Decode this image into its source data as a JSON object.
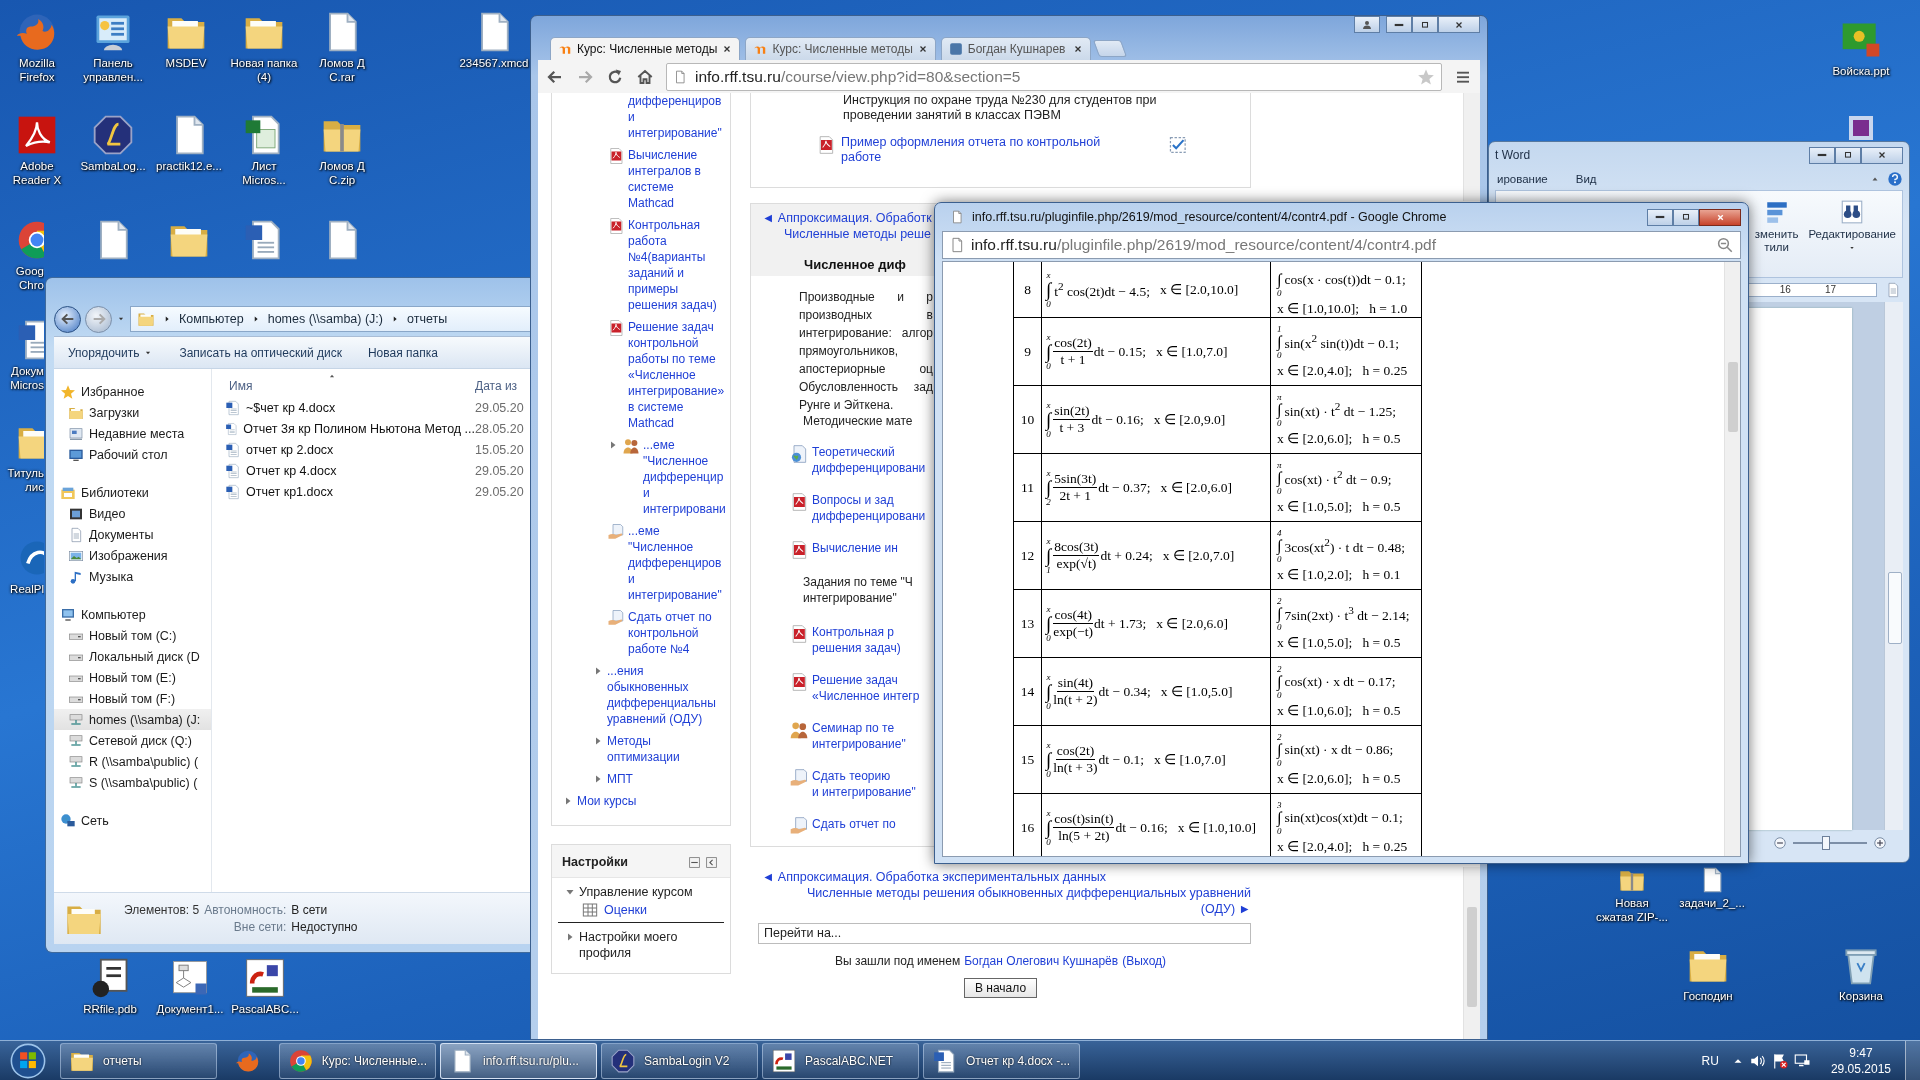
{
  "desktop_icons": [
    {
      "label": "Mozilla\nFirefox",
      "kind": "firefox"
    },
    {
      "label": "Панель\nуправлен...",
      "kind": "control-panel"
    },
    {
      "label": "MSDEV",
      "kind": "folder"
    },
    {
      "label": "Новая папка\n(4)",
      "kind": "folder"
    },
    {
      "label": "Ломов Д\nC.rar",
      "kind": "file"
    },
    {
      "label": "234567.xmcd",
      "kind": "file"
    },
    {
      "label": "Adobe\nReader X",
      "kind": "acrobat"
    },
    {
      "label": "SambaLog...",
      "kind": "samba"
    },
    {
      "label": "practik12.e...",
      "kind": "file"
    },
    {
      "label": "Лист\nMicros...",
      "kind": "excel"
    },
    {
      "label": "Ломов Д\nC.zip",
      "kind": "zip"
    },
    {
      "label": "Goog\nChro",
      "kind": "chrome"
    },
    {
      "kind": "file"
    },
    {
      "kind": "folder"
    },
    {
      "kind": "word"
    },
    {
      "kind": "file"
    },
    {
      "label": "Докум\nMicros",
      "kind": "word"
    },
    {
      "label": "Титуль\nлис",
      "kind": "folder"
    },
    {
      "label": "RealPl",
      "kind": "realplayer"
    },
    {
      "label": "RRfile.pdb",
      "kind": "pdb"
    },
    {
      "label": "Документ1...",
      "kind": "visio"
    },
    {
      "label": "PascalABC...",
      "kind": "pascal"
    },
    {
      "label": "Войска.ppt",
      "kind": "ppt"
    },
    {
      "kind": "media"
    },
    {
      "label": "Новая\nсжатая ZIP-...",
      "kind": "zip"
    },
    {
      "label": "задачи_2_...",
      "kind": "file"
    },
    {
      "label": "Господин",
      "kind": "folder"
    },
    {
      "label": "Корзина",
      "kind": "bin"
    }
  ],
  "explorer": {
    "breadcrumbs": [
      "Компьютер",
      "homes (\\\\samba) (J:)",
      "отчеты"
    ],
    "toolbar": [
      {
        "label": "Упорядочить",
        "menu": true
      },
      {
        "label": "Записать на оптический диск",
        "menu": false
      },
      {
        "label": "Новая папка",
        "menu": false
      }
    ],
    "nav": [
      {
        "label": "Избранное",
        "selected": false,
        "children": [
          {
            "label": "Загрузки",
            "selected": false
          },
          {
            "label": "Недавние места",
            "selected": false
          },
          {
            "label": "Рабочий стол",
            "selected": false
          }
        ]
      },
      {
        "label": "Библиотеки",
        "selected": false,
        "children": [
          {
            "label": "Видео",
            "selected": false
          },
          {
            "label": "Документы",
            "selected": false
          },
          {
            "label": "Изображения",
            "selected": false
          },
          {
            "label": "Музыка",
            "selected": false
          }
        ]
      },
      {
        "label": "Компьютер",
        "selected": false,
        "children": [
          {
            "label": "Новый том (C:)",
            "selected": false
          },
          {
            "label": "Локальный диск (D",
            "selected": false
          },
          {
            "label": "Новый том (E:)",
            "selected": false
          },
          {
            "label": "Новый том (F:)",
            "selected": false
          },
          {
            "label": "homes (\\\\samba) (J:",
            "selected": true
          },
          {
            "label": "Сетевой диск (Q:)",
            "selected": false
          },
          {
            "label": "R (\\\\samba\\public) (",
            "selected": false
          },
          {
            "label": "S (\\\\samba\\public) (",
            "selected": false
          }
        ]
      },
      {
        "label": "Сеть",
        "selected": false
      }
    ],
    "columns": [
      "Имя",
      "Дата из"
    ],
    "files": [
      {
        "name": "~$чет кр 4.docx",
        "date": "29.05.20"
      },
      {
        "name": "Отчет 3я кр Полином Ньютона Метод ...",
        "date": "28.05.20"
      },
      {
        "name": "отчет кр 2.docx",
        "date": "15.05.20"
      },
      {
        "name": "Отчет кр 4.docx",
        "date": "29.05.20"
      },
      {
        "name": "Отчет кр1.docx",
        "date": "29.05.20"
      }
    ],
    "status": {
      "count": "Элементов: 5",
      "offline_label": "Автономность:",
      "offline_value": "В сети",
      "outside_label": "Вне сети:",
      "outside_value": "Недоступно"
    }
  },
  "browser": {
    "tabs": [
      {
        "label": "Курс: Численные методы",
        "selected": true
      },
      {
        "label": "Курс: Численные методы",
        "selected": false
      },
      {
        "label": "Богдан Кушнарев",
        "selected": false
      }
    ],
    "url_host": "info.rff.tsu.ru",
    "url_path": "/course/view.php?id=80&section=5",
    "nav_tree": [
      {
        "children": [
          {
            "children": [
              {
                "kind": "link",
                "text": "дифференциров\nи\nинтегрирование\""
              },
              {
                "kind": "pdf",
                "text": "Вычисление\nинтегралов в\nсистеме\nMathcad"
              },
              {
                "kind": "pdf",
                "text": "Контрольная\nработа\n№4(варианты\nзаданий и\nпримеры\nрешения задач)"
              },
              {
                "kind": "pdf",
                "text": "Решение задач\nконтрольной\nработы по теме\n«Численное\nинтегрирование»\nв системе\nMathcad"
              },
              {
                "kind": "forum",
                "expanded": false,
                "text": "...еме\n\"Численное\nдифференцир\nи\nинтегрировани"
              },
              {
                "kind": "assign",
                "text": "...еме\n\"Численное\nдифференциров\nи\nинтегрирование\""
              },
              {
                "kind": "assign",
                "text": "Сдать отчет по\nконтрольной\nработе №4"
              }
            ]
          },
          {
            "text": "...ения\nобыкновенных\nдифференциальны\nуравнений (ОДУ)",
            "expanded": false
          },
          {
            "text": "Методы\nоптимизации",
            "expanded": false
          },
          {
            "text": "МПТ",
            "expanded": false
          }
        ]
      },
      {
        "text": "Мои курсы",
        "expanded": false
      }
    ],
    "settings": {
      "title": "Настройки",
      "items": [
        {
          "label": "Управление курсом",
          "expanded": true,
          "children": [
            {
              "label": "Оценки"
            }
          ]
        },
        {
          "label": "Настройки моего\nпрофиля",
          "expanded": false
        }
      ]
    },
    "top_box": {
      "lines": [
        "Инструкция по охране труда №230 для студентов при",
        "проведении занятий в классах ПЭВМ"
      ],
      "link": "Пример оформления отчета по контрольной\nработе",
      "done": true
    },
    "section": {
      "prev": "◄ Аппроксимация. Обработк",
      "next": "Численные методы реше",
      "title": "Численное диф",
      "summary": [
        "Производные и р",
        "производных в",
        "интегрирование: алгор",
        "прямоугольников,",
        "апостериорные оц",
        "Обусловленность зад",
        "Рунге и Эйткена."
      ],
      "materials": "Методические мате",
      "activities": [
        {
          "kind": "globe",
          "text": "Теоретический\nдифференцировани"
        },
        {
          "kind": "pdf",
          "text": "Вопросы и зад\nдифференцировани"
        },
        {
          "kind": "pdf",
          "text": "Вычисление ин"
        },
        {
          "kind": "label",
          "text": "Задания по теме \"Ч\nинтегрирование\""
        },
        {
          "kind": "pdf",
          "text": "Контрольная р\nрешения задач)"
        },
        {
          "kind": "pdf",
          "text": "Решение задач\n«Численное интегр"
        },
        {
          "kind": "forum",
          "text": "Семинар по те\nинтегрирование\""
        },
        {
          "kind": "assign",
          "text": "Сдать теорию\nи интегрирование\""
        },
        {
          "kind": "assign",
          "text": "Сдать отчет по"
        }
      ]
    },
    "bottom_nav": {
      "prev": "◄ Аппроксимация. Обработка экспериментальных данных",
      "next": "Численные методы решения обыкновенных дифференциальных уравнений\n(ОДУ) ►"
    },
    "jump": {
      "value": "Перейти на..."
    },
    "login": {
      "prefix": "Вы зашли под именем",
      "user": "Богдан Олегович Кушнарёв",
      "logout": "(Выход)"
    },
    "home_button": "В начало"
  },
  "pdf_viewer": {
    "title": "info.rff.tsu.ru/pluginfile.php/2619/mod_resource/content/4/contr4.pdf - Google Chrome",
    "url_host": "info.rff.tsu.ru",
    "url_path": "/pluginfile.php/2619/mod_resource/content/4/contr4.pdf",
    "rows": [
      {
        "n": "8",
        "a": {
          "kind": "plain",
          "sign": "∫",
          "upper": "x",
          "lower": "0",
          "body": "t$^{2}$ cos(2t)dt − 4.5;",
          "range": "x ∈ [2.0,10.0]"
        },
        "b": {
          "sign": "∫",
          "lower": "0",
          "body": "cos(x · cos(t))dt − 0.1;",
          "cond": "x ∈ [1.0,10.0];   h = 1.0"
        }
      },
      {
        "n": "9",
        "a": {
          "kind": "fraction",
          "sign": "∫",
          "upper": "x",
          "lower": "0",
          "num": "cos(2t)",
          "den": "t + 1",
          "tail": "dt − 0.15;",
          "range": "x ∈ [1.0,7.0]"
        },
        "b": {
          "sign": "∫",
          "upper": "1",
          "lower": "0",
          "body": "sin(x$^{2}$ sin(t))dt − 0.1;",
          "cond": "x ∈ [2.0,4.0];   h = 0.25"
        }
      },
      {
        "n": "10",
        "a": {
          "kind": "fraction",
          "sign": "∫",
          "upper": "x",
          "lower": "0",
          "num": "sin(2t)",
          "den": "t + 3",
          "tail": "dt − 0.16;",
          "range": "x ∈ [2.0,9.0]"
        },
        "b": {
          "sign": "∫",
          "upper": "π",
          "lower": "0",
          "body": "sin(xt) · t$^{2}$ dt − 1.25;",
          "cond": "x ∈ [2.0,6.0];   h = 0.5"
        }
      },
      {
        "n": "11",
        "a": {
          "kind": "fraction",
          "sign": "∫",
          "upper": "x",
          "lower": "2",
          "num": "5sin(3t)",
          "den": "2t + 1",
          "tail": "dt − 0.37;",
          "range": "x ∈ [2.0,6.0]"
        },
        "b": {
          "sign": "∫",
          "upper": "π",
          "lower": "0",
          "body": "cos(xt) · t$^{2}$ dt − 0.9;",
          "cond": "x ∈ [1.0,5.0];   h = 0.5"
        }
      },
      {
        "n": "12",
        "a": {
          "kind": "fraction",
          "sign": "∫",
          "upper": "x",
          "lower": "1",
          "num": "8cos(3t)",
          "den": "exp(√t)",
          "tail": "dt + 0.24;",
          "range": "x ∈ [2.0,7.0]"
        },
        "b": {
          "sign": "∫",
          "upper": "4",
          "lower": "0",
          "body": "3cos(xt$^{2}$) · t dt − 0.48;",
          "cond": "x ∈ [1.0,2.0];   h = 0.1"
        }
      },
      {
        "n": "13",
        "a": {
          "kind": "fraction",
          "sign": "∫",
          "upper": "x",
          "lower": "0",
          "num": "cos(4t)",
          "den": "exp(−t)",
          "tail": "dt + 1.73;",
          "range": "x ∈ [2.0,6.0]"
        },
        "b": {
          "sign": "∫",
          "upper": "2",
          "lower": "0",
          "body": "7sin(2xt) · t$^{3}$ dt − 2.14;",
          "cond": "x ∈ [1.0,5.0];   h = 0.5"
        }
      },
      {
        "n": "14",
        "a": {
          "kind": "fraction",
          "sign": "∫",
          "upper": "x",
          "lower": "0",
          "num": "sin(4t)",
          "den": "ln(t + 2)",
          "tail": "dt − 0.34;",
          "range": "x ∈ [1.0,5.0]"
        },
        "b": {
          "sign": "∫",
          "upper": "2",
          "lower": "0",
          "body": "cos(xt) · x dt − 0.17;",
          "cond": "x ∈ [1.0,6.0];   h = 0.5"
        }
      },
      {
        "n": "15",
        "a": {
          "kind": "fraction",
          "sign": "∫",
          "upper": "x",
          "lower": "0",
          "num": "cos(2t)",
          "den": "ln(t + 3)",
          "tail": "dt − 0.1;",
          "range": "x ∈ [1.0,7.0]"
        },
        "b": {
          "sign": "∫",
          "upper": "2",
          "lower": "0",
          "body": "sin(xt) · x dt − 0.86;",
          "cond": "x ∈ [2.0,6.0];   h = 0.5"
        }
      },
      {
        "n": "16",
        "a": {
          "kind": "fraction",
          "sign": "∫",
          "upper": "x",
          "lower": "0",
          "num": "cos(t)sin(t)",
          "den": "ln(5 + 2t)",
          "tail": "dt − 0.16;",
          "range": "x ∈ [1.0,10.0]"
        },
        "b": {
          "sign": "∫",
          "upper": "3",
          "lower": "0",
          "body": "sin(xt)cos(xt)dt − 0.1;",
          "cond": "x ∈ [2.0,4.0];   h = 0.25"
        }
      }
    ]
  },
  "word": {
    "title": "t Word",
    "tabs": [
      {
        "label": "ирование",
        "selected": false
      },
      {
        "label": "Вид",
        "selected": false
      }
    ],
    "styles": "зменить\nтили",
    "editing": "Редактирование",
    "ruler": [
      "16",
      "17"
    ],
    "zoom": {
      "level": 0.45
    }
  },
  "taskbar": {
    "items": [
      {
        "label": "отчеты",
        "kind": "folder",
        "selected": false
      },
      {
        "kind": "firefox",
        "selected": false
      },
      {
        "label": "Курс: Численные...",
        "kind": "chrome",
        "selected": false
      },
      {
        "label": "info.rff.tsu.ru/plu...",
        "kind": "file",
        "selected": true
      },
      {
        "label": "SambaLogin V2",
        "kind": "samba",
        "selected": false
      },
      {
        "label": "PascalABC.NET",
        "kind": "pascal",
        "selected": false
      },
      {
        "label": "Отчет кр 4.docx -...",
        "kind": "word",
        "selected": false
      }
    ],
    "language": "RU",
    "time": "9:47",
    "date": "29.05.2015"
  }
}
